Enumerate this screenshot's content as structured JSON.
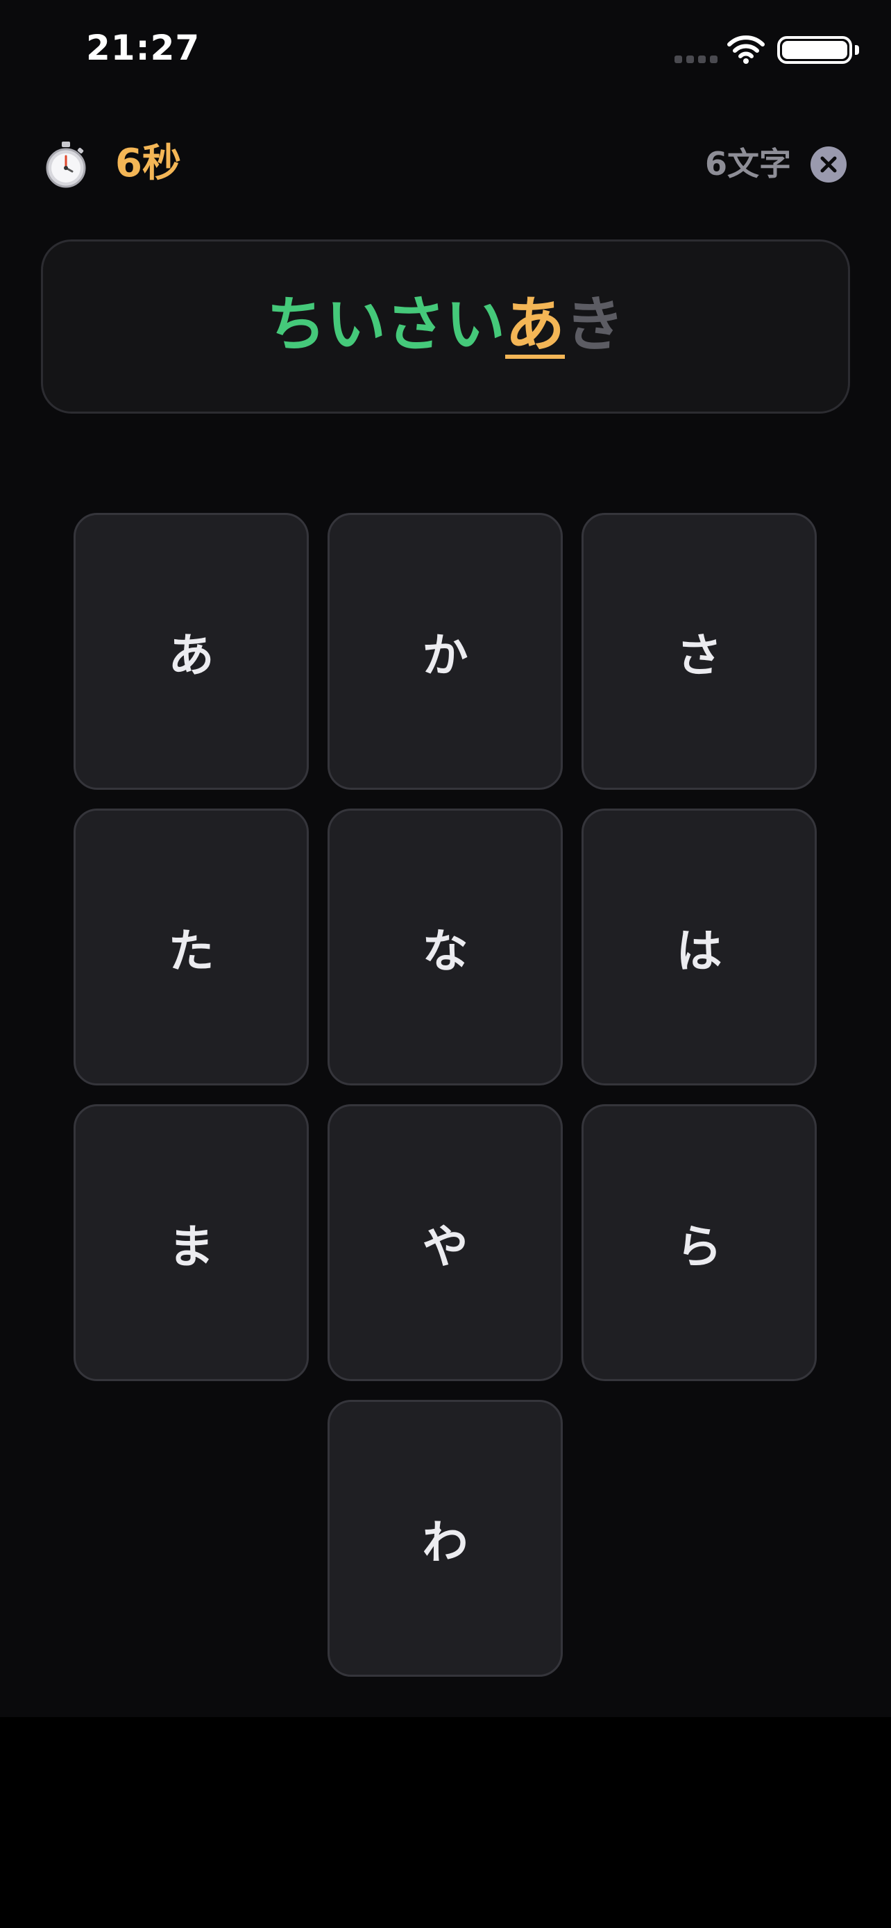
{
  "status_bar": {
    "time": "21:27",
    "signal_icon": "cellular-signal-icon",
    "wifi_icon": "wifi-icon",
    "battery_icon": "battery-icon"
  },
  "header": {
    "timer_icon": "stopwatch-icon",
    "timer": "6秒",
    "char_count": "6文字",
    "close_icon": "close-icon"
  },
  "word": {
    "done": "ちいさい",
    "current": "あ",
    "pending": "き"
  },
  "keys": [
    "あ",
    "か",
    "さ",
    "た",
    "な",
    "は",
    "ま",
    "や",
    "ら",
    "わ"
  ],
  "colors": {
    "background": "#0a0a0c",
    "done": "#45c97a",
    "current": "#f4b656",
    "pending": "#5c5c63",
    "key_bg": "#1f1f23"
  }
}
